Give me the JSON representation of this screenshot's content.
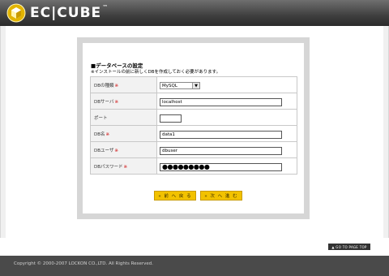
{
  "header": {
    "logo_text": "EC|CUBE",
    "logo_tm": "™"
  },
  "section": {
    "title": "■データベースの設定",
    "note": "※インストールの前に新しくDBを作成しておく必要があります。"
  },
  "form": {
    "required_mark": "※",
    "db_type": {
      "label": "DBの種類",
      "value": "MySQL"
    },
    "db_server": {
      "label": "DBサーバ",
      "value": "localhost"
    },
    "port": {
      "label": "ポート",
      "value": ""
    },
    "db_name": {
      "label": "DB名",
      "value": "data1"
    },
    "db_user": {
      "label": "DBユーザ",
      "value": "dbuser"
    },
    "db_password": {
      "label": "DBパスワード",
      "value": "●●●●●●●●●"
    }
  },
  "buttons": {
    "back": "« 前 へ 戻 る",
    "next": "» 次 へ 進 む"
  },
  "page_top": "▲ GO TO PAGE TOP",
  "footer": {
    "copyright": "Copyright © 2000-2007 LOCKON CO.,LTD. All Rights Reserved."
  },
  "colors": {
    "accent": "#f2c200",
    "required": "#cc0000",
    "header_bg": "#3f3f3f"
  }
}
